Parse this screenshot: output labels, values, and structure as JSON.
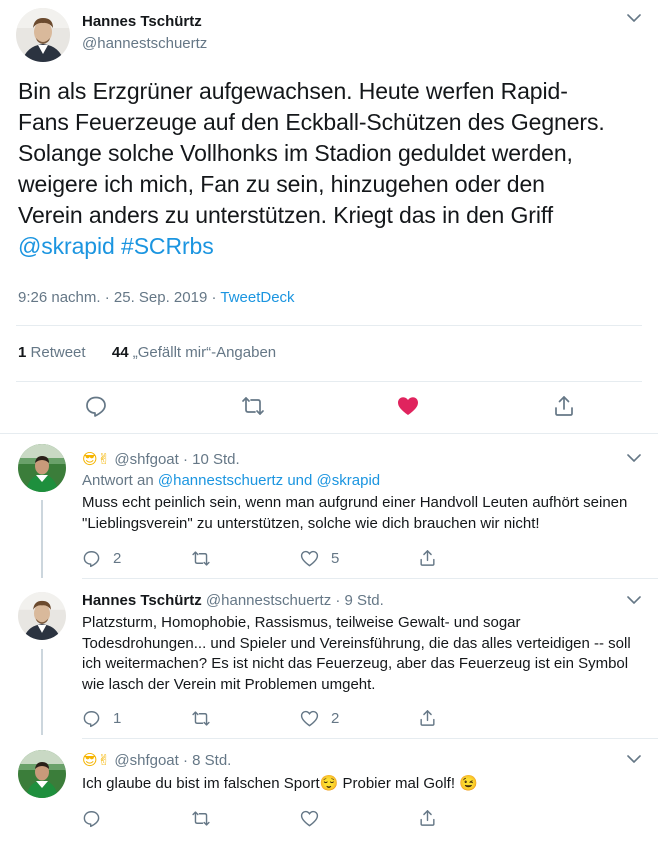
{
  "main": {
    "name": "Hannes Tschürtz",
    "handle": "@hannestschuertz",
    "text_lines": [
      "Bin als Erzgrüner aufgewachsen. Heute werfen Rapid-",
      "Fans Feuerzeuge auf den Eckball-Schützen des Gegners.",
      "Solange solche Vollhonks im Stadion geduldet werden,",
      "weigere ich mich, Fan zu sein, hinzugehen oder den",
      "Verein anders zu unterstützen. Kriegt das in den Griff"
    ],
    "mention": "@skrapid",
    "hashtag": "#SCRrbs",
    "timestamp": "9:26 nachm. · 25. Sep. 2019 · ",
    "source": "TweetDeck",
    "retweet_count": "1",
    "retweet_label": "Retweet",
    "like_count": "44",
    "like_label": "„Gefällt mir“-Angaben",
    "like_color": "#e0245e"
  },
  "replies": [
    {
      "emoji": "😎✌",
      "name": "",
      "handle": "@shfgoat",
      "time": " · 10 Std.",
      "reply_to_prefix": "Antwort an ",
      "reply_to_links": "@hannestschuertz und @skrapid",
      "text": "Muss echt peinlich sein, wenn man aufgrund einer Handvoll Leuten aufhört seinen \"Lieblingsverein\" zu unterstützen, solche wie dich brauchen wir nicht!",
      "replies": "2",
      "retweets": "",
      "likes": "5"
    },
    {
      "emoji": "",
      "name": "Hannes Tschürtz",
      "handle": "@hannestschuertz",
      "time": " · 9 Std.",
      "text": "Platzsturm, Homophobie, Rassismus, teilweise Gewalt- und sogar Todesdrohungen... und Spieler und Vereinsführung, die das alles verteidigen -- soll ich weitermachen? Es ist nicht das Feuerzeug, aber das Feuerzeug ist ein Symbol wie lasch der Verein mit Problemen umgeht.",
      "replies": "1",
      "retweets": "",
      "likes": "2"
    },
    {
      "emoji": "😎✌",
      "name": "",
      "handle": "@shfgoat",
      "time": " · 8 Std.",
      "text": "Ich glaube du bist im falschen Sport😌 Probier mal Golf! 😉",
      "replies": "",
      "retweets": "",
      "likes": ""
    }
  ]
}
